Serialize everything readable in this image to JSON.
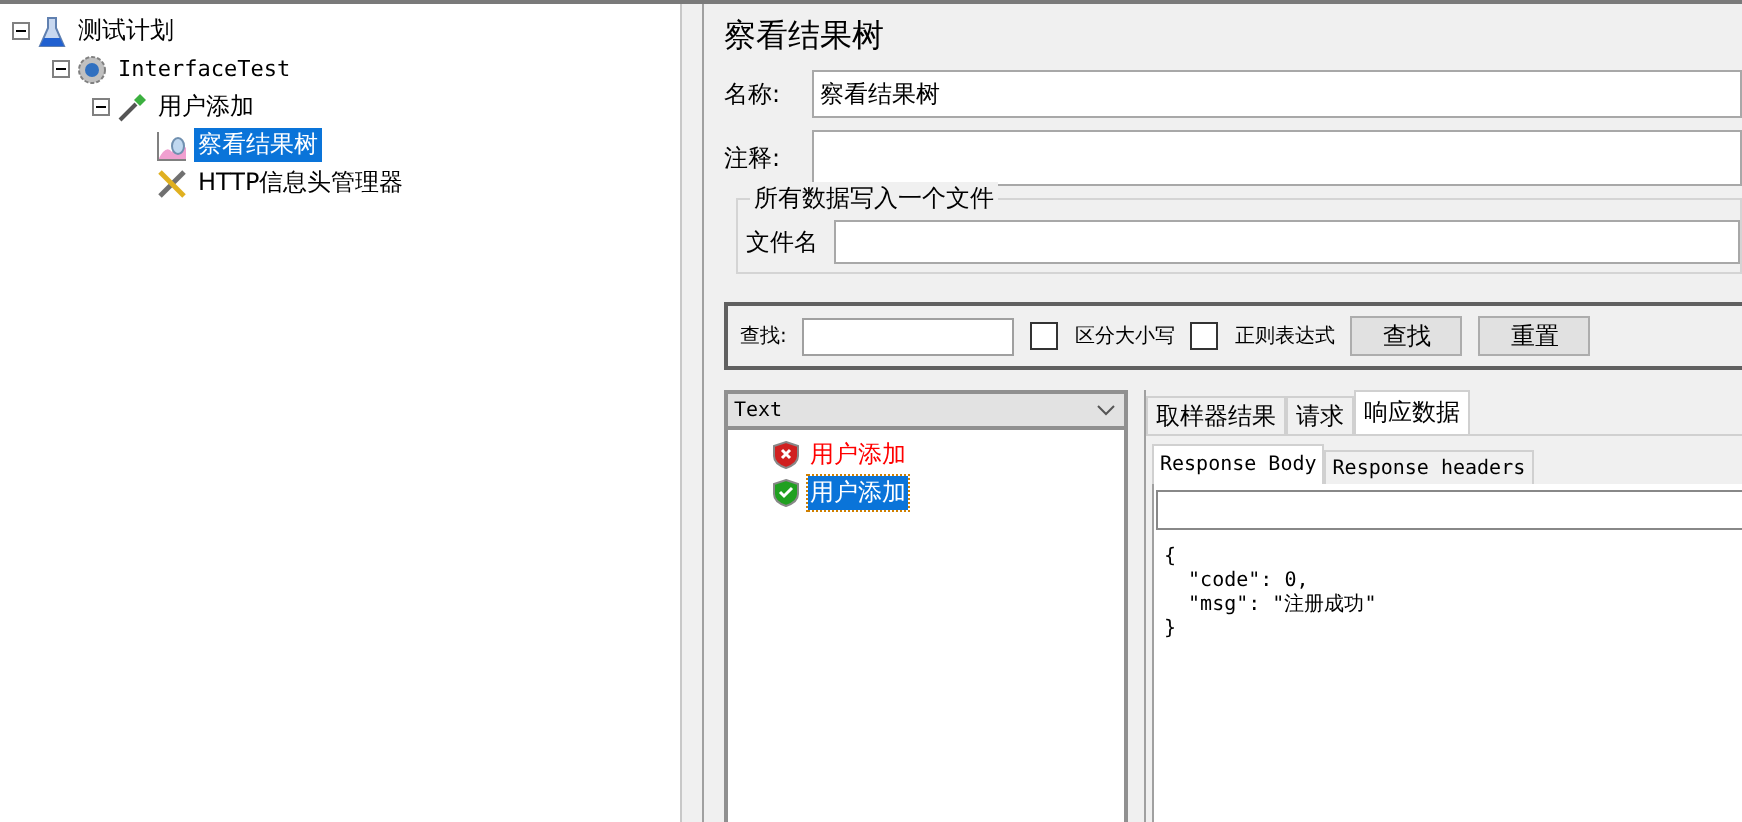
{
  "tree": [
    {
      "label": "测试计划",
      "kind": "plan",
      "expanded": true,
      "selected": false,
      "children": [
        {
          "label": "InterfaceTest",
          "kind": "group",
          "expanded": true,
          "selected": false,
          "children": [
            {
              "label": "用户添加",
              "kind": "sampler",
              "expanded": true,
              "selected": false,
              "children": [
                {
                  "label": "察看结果树",
                  "kind": "listener",
                  "selected": true
                },
                {
                  "label": "HTTP信息头管理器",
                  "kind": "config",
                  "selected": false
                }
              ]
            }
          ]
        }
      ]
    }
  ],
  "panel": {
    "title": "察看结果树",
    "name_label": "名称:",
    "name_value": "察看结果树",
    "comment_label": "注释:",
    "file_group": "所有数据写入一个文件",
    "file_label": "文件名"
  },
  "search": {
    "label": "查找:",
    "options": [
      {
        "label": "区分大小写",
        "checked": false
      },
      {
        "label": "正则表达式",
        "checked": false
      }
    ],
    "buttons": [
      "查找",
      "重置"
    ]
  },
  "results": {
    "column": "Text",
    "items": [
      {
        "label": "用户添加",
        "kind": "error",
        "selected": false
      },
      {
        "label": "用户添加",
        "kind": "success",
        "selected": true
      }
    ]
  },
  "tabs": [
    {
      "label": "取样器结果",
      "selected": false
    },
    {
      "label": "请求",
      "selected": false
    },
    {
      "label": "响应数据",
      "selected": true
    }
  ],
  "subtabs": [
    {
      "label": "Response Body",
      "selected": true
    },
    {
      "label": "Response headers",
      "selected": false
    }
  ],
  "body": [
    "{",
    "  \"code\": 0,",
    "  \"msg\": \"注册成功\"",
    "}"
  ]
}
